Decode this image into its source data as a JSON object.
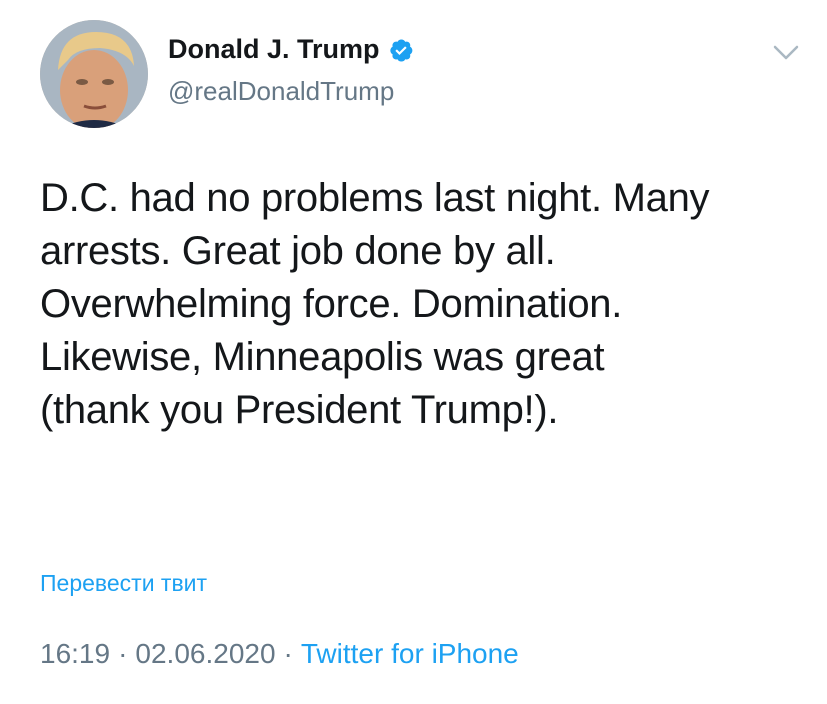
{
  "tweet": {
    "author": {
      "display_name": "Donald J. Trump",
      "handle": "@realDonaldTrump",
      "verified": true
    },
    "text": "D.C. had no problems last night. Many\narrests. Great job done by all.\nOverwhelming force. Domination.\nLikewise, Minneapolis was great\n(thank you President Trump!).",
    "translate_label": "Перевести твит",
    "time": "16:19",
    "date": "02.06.2020",
    "separator": "·",
    "source": "Twitter for iPhone"
  },
  "icons": {
    "verified": "verified-badge-icon",
    "menu": "chevron-down-icon"
  },
  "colors": {
    "accent": "#1da1f2",
    "secondary_text": "#657786",
    "primary_text": "#14171a"
  }
}
